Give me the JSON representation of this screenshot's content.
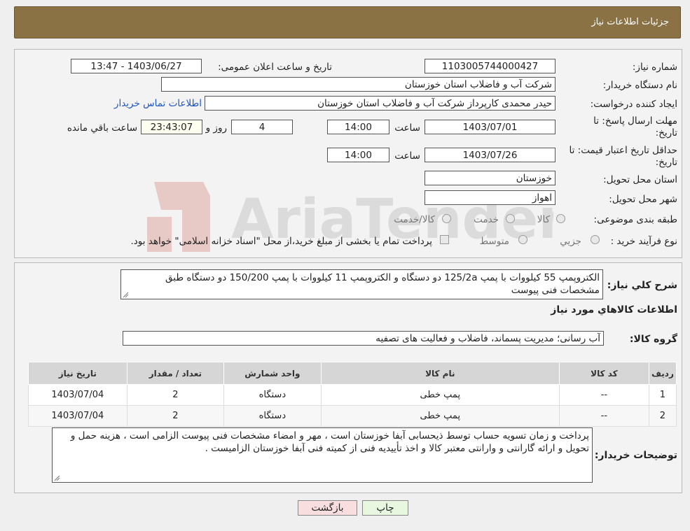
{
  "header": {
    "title": "جزئیات اطلاعات نیاز"
  },
  "need_number": {
    "label": "شماره نیاز:",
    "value": "1103005744000427"
  },
  "announce": {
    "label": "تاریخ و ساعت اعلان عمومی:",
    "value": "1403/06/27 - 13:47"
  },
  "buyer_org": {
    "label": "نام دستگاه خریدار:",
    "value": "شرکت آب و فاضلاب استان خوزستان"
  },
  "requester": {
    "label": "ایجاد کننده درخواست:",
    "value": "حیدر محمدی کارپرداز شرکت آب و فاضلاب استان خوزستان",
    "contact_link": "اطلاعات تماس خریدار"
  },
  "reply_deadline": {
    "label_line1": "مهلت ارسال پاسخ: تا",
    "label_line2": "تاریخ:",
    "date": "1403/07/01",
    "time_label": "ساعت",
    "time": "14:00",
    "days": "4",
    "days_label": "روز و",
    "remaining": "23:43:07",
    "remaining_label": "ساعت باقي مانده"
  },
  "price_validity": {
    "label_line1": "حداقل تاریخ اعتبار قیمت: تا",
    "label_line2": "تاریخ:",
    "date": "1403/07/26",
    "time_label": "ساعت",
    "time": "14:00"
  },
  "province": {
    "label": "استان محل تحویل:",
    "value": "خوزستان"
  },
  "city": {
    "label": "شهر محل تحویل:",
    "value": "اهواز"
  },
  "category": {
    "label": "طبقه بندی موضوعی:",
    "options": [
      "کالا",
      "خدمت",
      "کالا/خدمت"
    ]
  },
  "process": {
    "label": "نوع فرآیند خرید :",
    "options": [
      "جزیي",
      "متوسط"
    ],
    "note": "پرداخت تمام یا بخشی از مبلغ خرید،از محل \"اسناد خزانه اسلامی\" خواهد بود."
  },
  "watermark": {
    "text": "AriaTender.neT"
  },
  "general_desc": {
    "label": "شرح کلي نیاز:",
    "value": "الکتروپمپ 55 کیلووات با پمپ 125/2a دو دستگاه و الکتروپمپ 11 کیلووات با پمپ 150/200 دو دستگاه طبق مشخصات فنی پیوست"
  },
  "goods_info_title": "اطلاعات کالاهاي مورد نیاز",
  "goods_group": {
    "label": "گروه کالا:",
    "value": "آب رسانی؛ مدیریت پسماند، فاضلاب و فعالیت های تصفیه"
  },
  "table": {
    "headers": [
      "ردیف",
      "کد کالا",
      "نام کالا",
      "واحد شمارش",
      "تعداد / مقدار",
      "تاریخ نیاز"
    ],
    "rows": [
      [
        "1",
        "--",
        "پمپ خطی",
        "دستگاه",
        "2",
        "1403/07/04"
      ],
      [
        "2",
        "--",
        "پمپ خطی",
        "دستگاه",
        "2",
        "1403/07/04"
      ]
    ]
  },
  "buyer_notes": {
    "label": "توضیحات خریدار:",
    "value": "پرداخت و زمان تسویه حساب توسط ذیحسابی آبفا خوزستان است ، مهر و امضاء مشخصات فنی پیوست الزامی است ، هزینه حمل و تحویل و ارائه گارانتی و وارانتی معتبر کالا و اخذ تأییدیه فنی از کمیته فنی آبفا خوزستان الزامیست ."
  },
  "buttons": {
    "print": "چاپ",
    "back": "بازگشت"
  },
  "colors": {
    "header_bg": "#8b7244",
    "link": "#1d55c4",
    "print_btn": "#e8f7e0",
    "back_btn": "#f8dede"
  }
}
